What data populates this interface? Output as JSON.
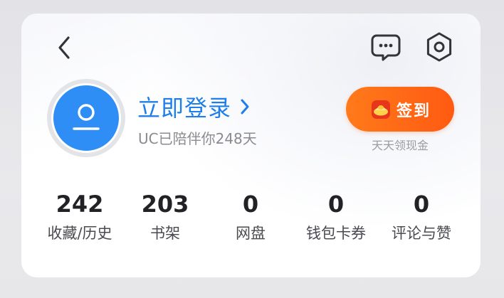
{
  "header": {
    "back_icon": "chevron-left-icon",
    "message_icon": "chat-bubble-icon",
    "settings_icon": "gear-icon"
  },
  "profile": {
    "avatar_icon": "user-avatar-icon",
    "login_label": "立即登录",
    "login_arrow_icon": "chevron-right-icon",
    "days_text": "UC已陪伴你248天"
  },
  "checkin": {
    "icon": "gold-ingot-icon",
    "label": "签到",
    "subtitle": "天天领现金"
  },
  "stats": [
    {
      "value": "242",
      "label": "收藏/历史"
    },
    {
      "value": "203",
      "label": "书架"
    },
    {
      "value": "0",
      "label": "网盘"
    },
    {
      "value": "0",
      "label": "钱包卡券"
    },
    {
      "value": "0",
      "label": "评论与赞"
    }
  ],
  "colors": {
    "accent_blue": "#1f7fe9",
    "avatar_blue": "#2f8ef6",
    "checkin_orange": "#ff6a16"
  }
}
